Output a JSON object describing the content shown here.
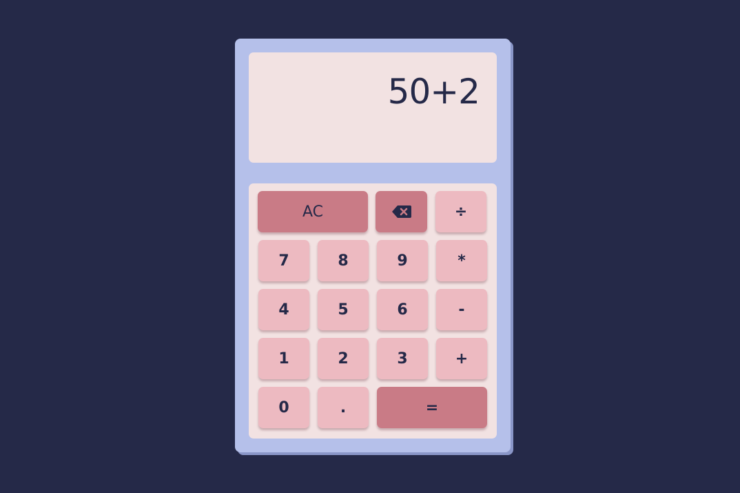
{
  "display": {
    "value": "50+2"
  },
  "keys": {
    "clear": "AC",
    "divide": "÷",
    "seven": "7",
    "eight": "8",
    "nine": "9",
    "multiply": "*",
    "four": "4",
    "five": "5",
    "six": "6",
    "subtract": "-",
    "one": "1",
    "two": "2",
    "three": "3",
    "add": "+",
    "zero": "0",
    "decimal": ".",
    "equals": "="
  },
  "icons": {
    "backspace": "backspace-icon"
  },
  "colors": {
    "background": "#252948",
    "frame": "#b5c0ea",
    "panel": "#f2e2e2",
    "key": "#edbac1",
    "key_accent": "#c97b86",
    "text": "#252948"
  }
}
